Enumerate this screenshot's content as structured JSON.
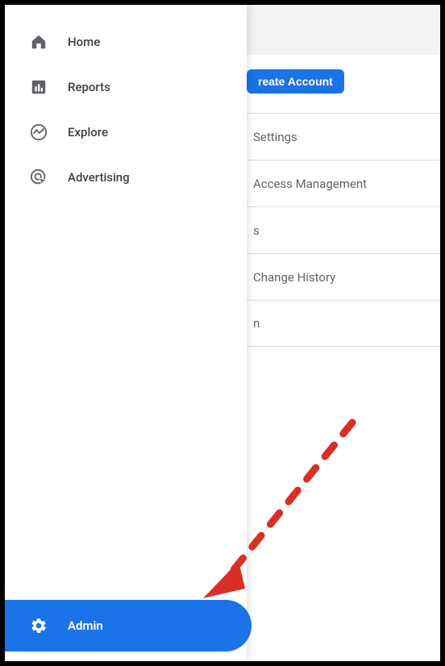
{
  "sidebar": {
    "items": [
      {
        "label": "Home"
      },
      {
        "label": "Reports"
      },
      {
        "label": "Explore"
      },
      {
        "label": "Advertising"
      }
    ],
    "admin_label": "Admin"
  },
  "content": {
    "create_button_label": "reate Account",
    "rows": [
      "Settings",
      "Access Management",
      "s",
      "Change History",
      "n"
    ]
  },
  "colors": {
    "primary": "#1a73e8",
    "annotation": "#d93025"
  }
}
